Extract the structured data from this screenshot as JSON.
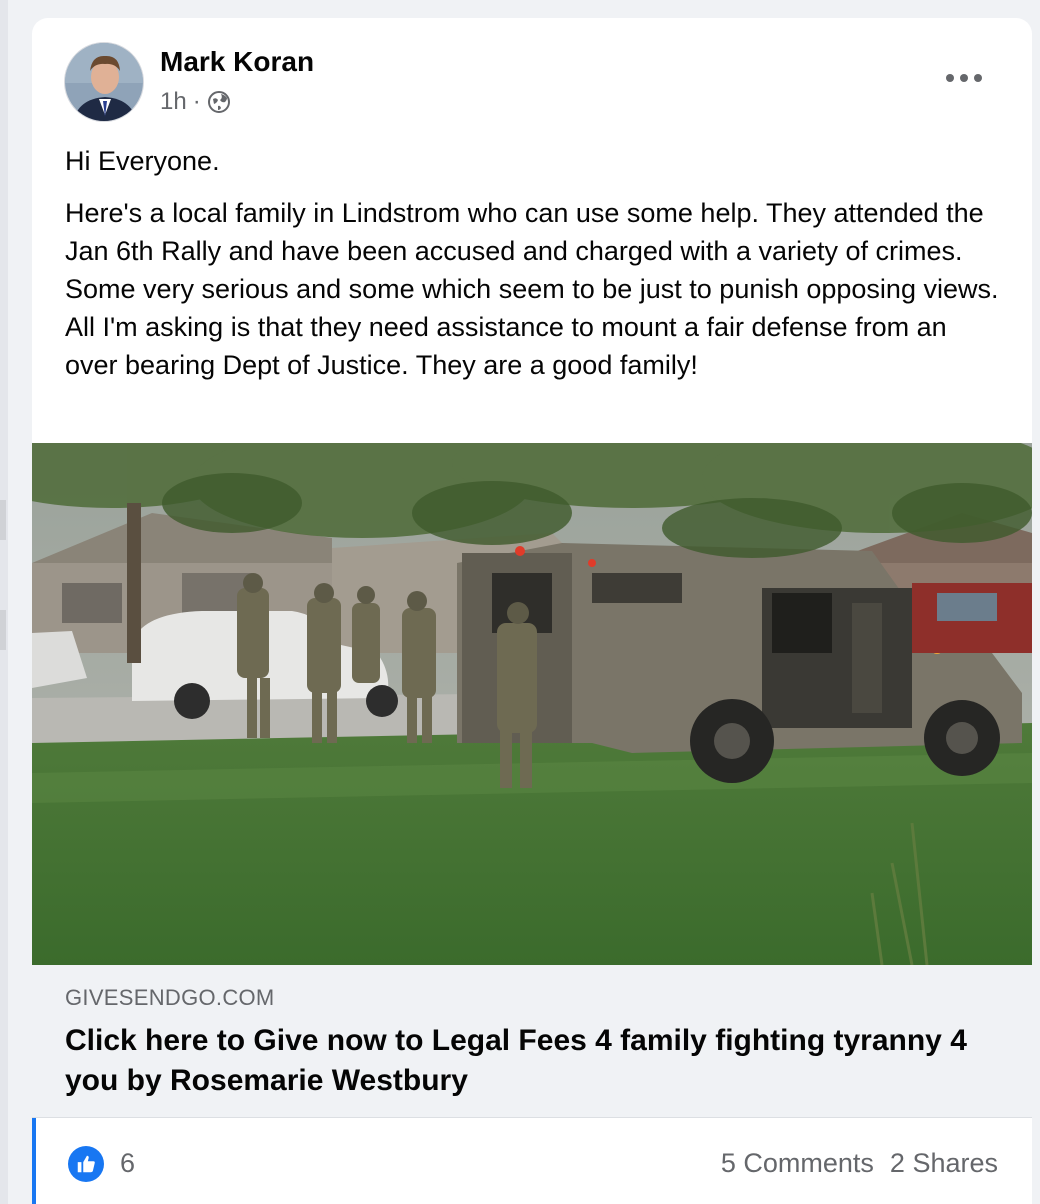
{
  "post": {
    "author": "Mark Koran",
    "time": "1h",
    "separator": "·",
    "privacy_icon": "globe-icon",
    "greeting": "Hi Everyone.",
    "message": "Here's a local family in Lindstrom who can use some help. They attended the Jan 6th Rally and have been accused and charged with a variety of crimes. Some very serious and some which seem to be just to punish opposing views. All I'm asking is that they need assistance to mount a fair defense from an over bearing Dept of Justice. They are a good family!"
  },
  "link": {
    "domain": "GIVESENDGO.COM",
    "title": "Click here to Give now to Legal Fees 4 family fighting tyranny 4 you by Rosemarie Westbury"
  },
  "stats": {
    "likes": "6",
    "comments": "5 Comments",
    "shares": "2 Shares"
  },
  "colors": {
    "accent": "#1877f2",
    "secondary_text": "#65676b"
  }
}
